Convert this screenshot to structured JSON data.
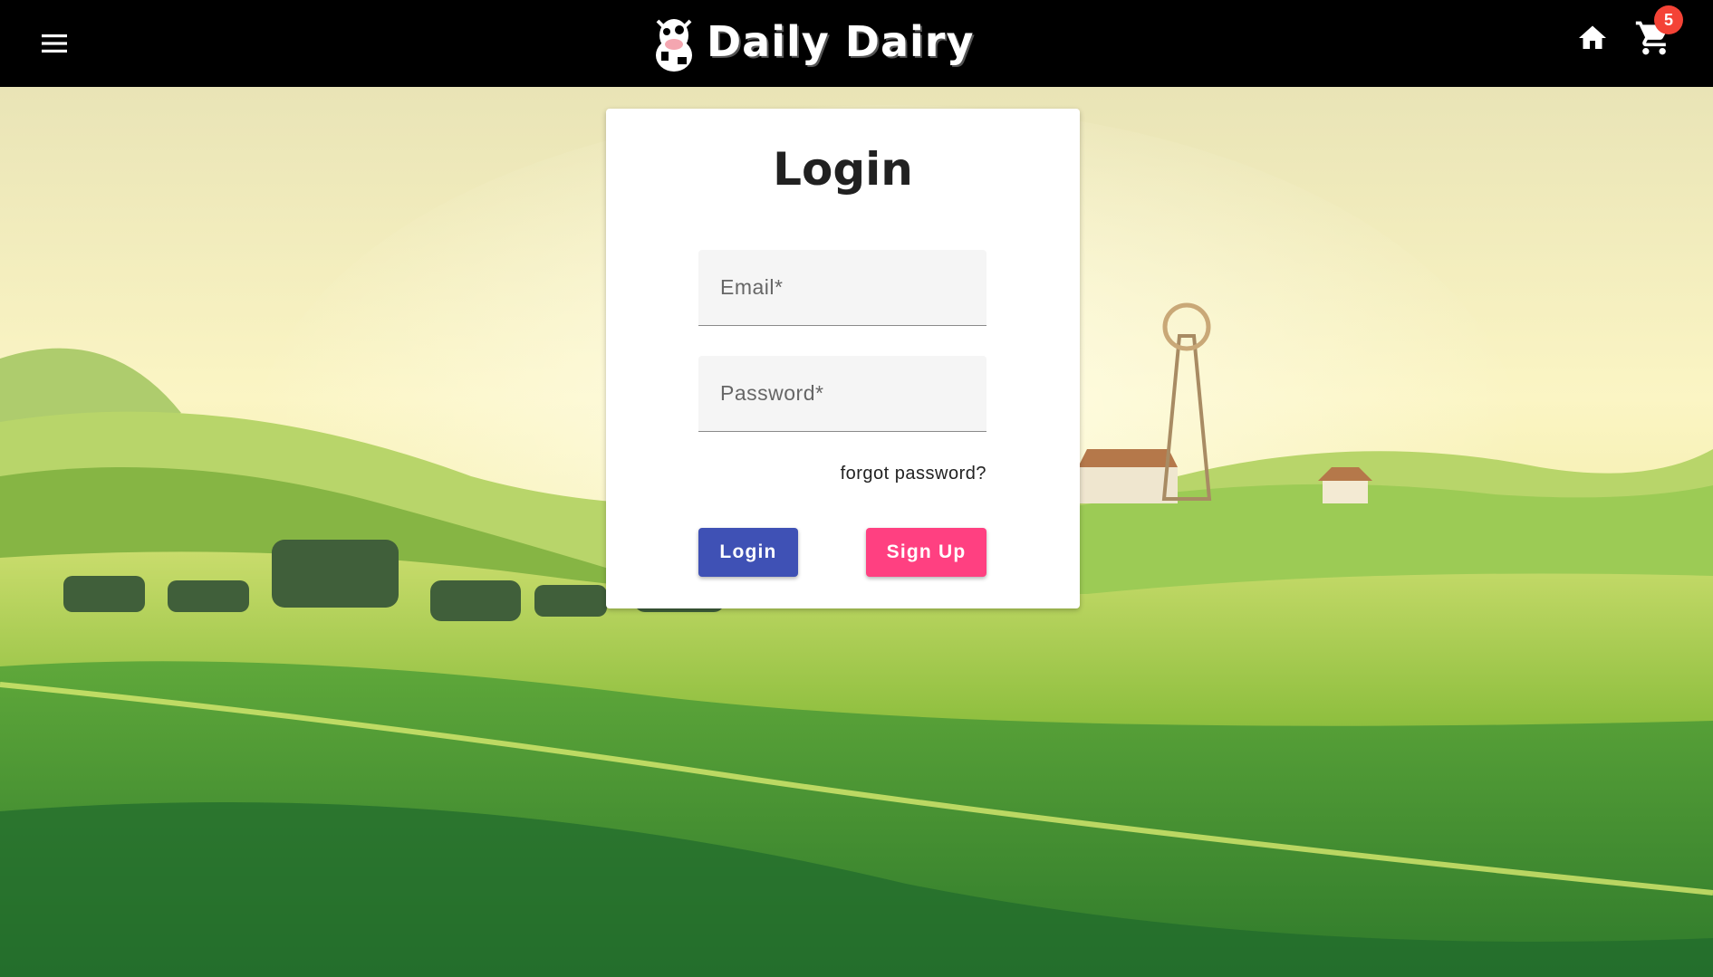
{
  "app": {
    "brand": "Daily Dairy"
  },
  "header": {
    "menu_icon": "hamburger-menu-icon",
    "home_icon": "home-icon",
    "cart_icon": "shopping-cart-icon",
    "cart_count": "5"
  },
  "login": {
    "title": "Login",
    "email_placeholder": "Email*",
    "password_placeholder": "Password*",
    "forgot_label": "forgot password?",
    "login_label": "Login",
    "signup_label": "Sign Up"
  },
  "colors": {
    "topbar": "#000000",
    "primary": "#3f51b5",
    "accent": "#ff4081",
    "badge": "#f44336"
  }
}
